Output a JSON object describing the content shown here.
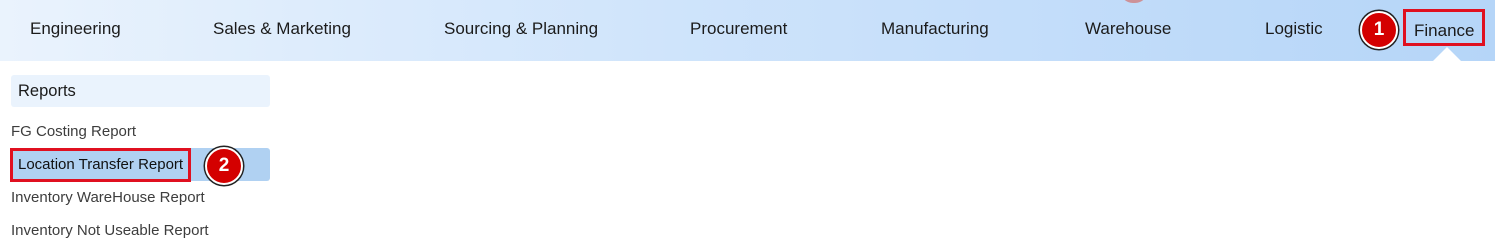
{
  "nav": {
    "items": [
      {
        "label": "Engineering"
      },
      {
        "label": "Sales & Marketing"
      },
      {
        "label": "Sourcing & Planning"
      },
      {
        "label": "Procurement"
      },
      {
        "label": "Manufacturing"
      },
      {
        "label": "Warehouse"
      },
      {
        "label": "Logistic"
      },
      {
        "label": "Finance",
        "active": true
      }
    ]
  },
  "sidebar": {
    "header": "Reports",
    "items": [
      {
        "label": "FG Costing Report"
      },
      {
        "label": "Location Transfer Report",
        "selected": true
      },
      {
        "label": "Inventory WareHouse Report"
      },
      {
        "label": "Inventory Not Useable Report"
      }
    ]
  },
  "markers": [
    {
      "label": "1"
    },
    {
      "label": "2"
    }
  ],
  "colors": {
    "accent_red": "#e01020",
    "nav_gradient_start": "#eaf3fd",
    "nav_gradient_end": "#b5d5f8",
    "selected_bg": "#b0d1f2"
  }
}
